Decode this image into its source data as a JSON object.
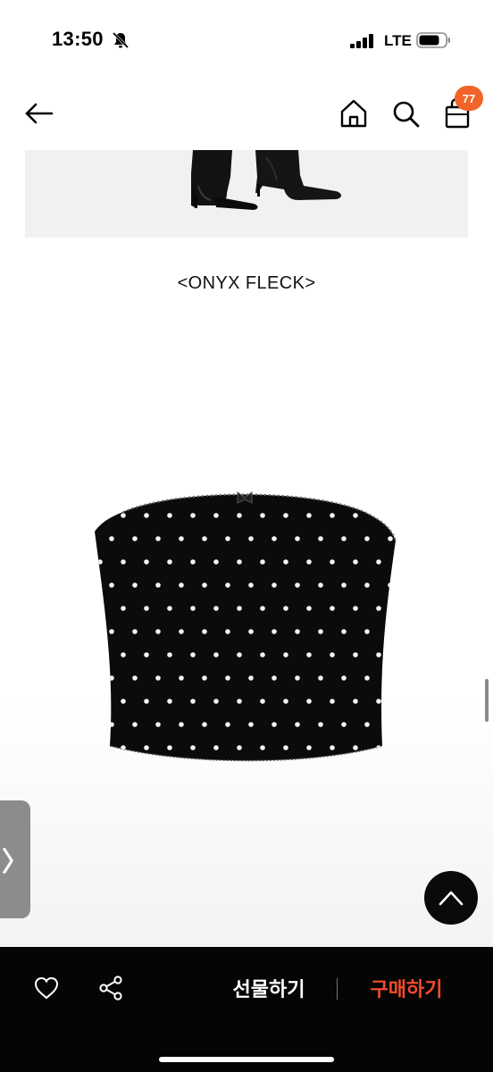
{
  "status_bar": {
    "time": "13:50",
    "network": "LTE",
    "icons": [
      "bell-slash-icon",
      "signal-icon",
      "battery-icon"
    ]
  },
  "header": {
    "icons": [
      "back-arrow-icon",
      "home-icon",
      "search-icon",
      "shopping-bag-icon"
    ],
    "cart_count": "77",
    "accent_color": "#f0642a"
  },
  "product": {
    "section_title": "<ONYX FLECK>"
  },
  "side_tab": {
    "glyph": "〉"
  },
  "bottom_bar": {
    "icons": [
      "heart-icon",
      "share-icon"
    ],
    "gift_label": "선물하기",
    "buy_label": "구매하기",
    "buy_color": "#f24b2a"
  }
}
